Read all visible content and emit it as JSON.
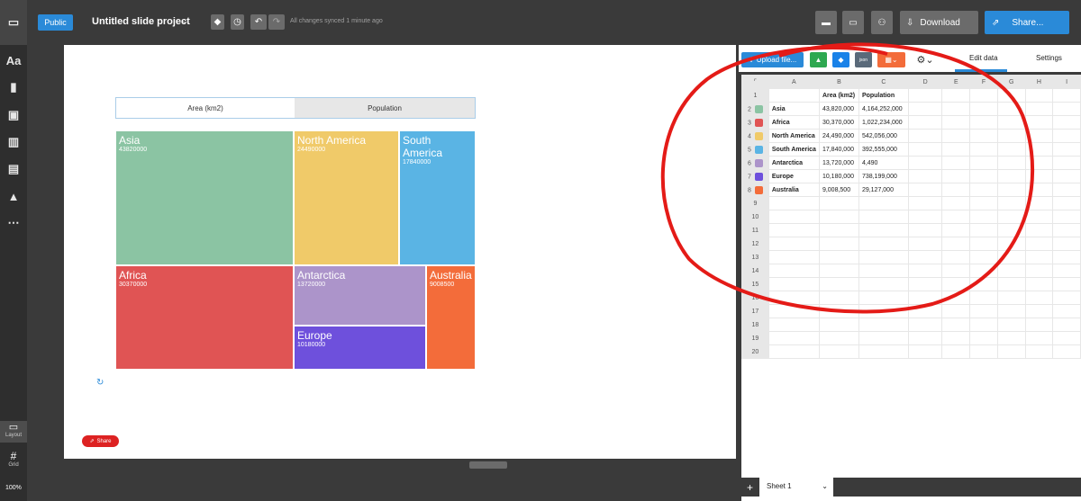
{
  "toolbar": {
    "public_label": "Public",
    "title": "Untitled slide project",
    "sync_text": "All changes synced 1 minute ago",
    "download_label": "Download",
    "share_label": "Share..."
  },
  "left_sidebar": {
    "text_tool": "Aa",
    "layout_label": "Layout",
    "grid_label": "Grid",
    "zoom": "100%"
  },
  "chart": {
    "tabs": [
      "Area (km2)",
      "Population"
    ],
    "share_label": "Share",
    "cells": [
      {
        "name": "Asia",
        "value": "43820000",
        "color": "#8bc4a3"
      },
      {
        "name": "North America",
        "value": "24490000",
        "color": "#f0ca69"
      },
      {
        "name": "South America",
        "value": "17840000",
        "color": "#5ab4e4"
      },
      {
        "name": "Africa",
        "value": "30370000",
        "color": "#e05454"
      },
      {
        "name": "Antarctica",
        "value": "13720000",
        "color": "#ac94ca"
      },
      {
        "name": "Australia",
        "value": "9008500",
        "color": "#f36c3a"
      },
      {
        "name": "Europe",
        "value": "10180000",
        "color": "#6e50dc"
      }
    ]
  },
  "chart_data": {
    "type": "treemap",
    "series": "Area (km2)",
    "categories": [
      "Asia",
      "Africa",
      "North America",
      "South America",
      "Antarctica",
      "Europe",
      "Australia"
    ],
    "values": [
      43820000,
      30370000,
      24490000,
      17840000,
      13720000,
      10180000,
      9008500
    ]
  },
  "panel": {
    "upload_label": "Upload file...",
    "tabs": {
      "edit": "Edit data",
      "settings": "Settings"
    },
    "sheet_name": "Sheet 1",
    "columns": [
      "A",
      "B",
      "C",
      "D",
      "E",
      "F",
      "G",
      "H",
      "I"
    ],
    "header_row": [
      "",
      "Area (km2)",
      "Population"
    ],
    "rows": [
      {
        "n": "2",
        "name": "Asia",
        "area": "43,820,000",
        "pop": "4,164,252,000",
        "color": "#8bc4a3"
      },
      {
        "n": "3",
        "name": "Africa",
        "area": "30,370,000",
        "pop": "1,022,234,000",
        "color": "#e05454"
      },
      {
        "n": "4",
        "name": "North America",
        "area": "24,490,000",
        "pop": "542,056,000",
        "color": "#f0ca69"
      },
      {
        "n": "5",
        "name": "South America",
        "area": "17,840,000",
        "pop": "392,555,000",
        "color": "#5ab4e4"
      },
      {
        "n": "6",
        "name": "Antarctica",
        "area": "13,720,000",
        "pop": "4,490",
        "color": "#ac94ca"
      },
      {
        "n": "7",
        "name": "Europe",
        "area": "10,180,000",
        "pop": "738,199,000",
        "color": "#6e50dc"
      },
      {
        "n": "8",
        "name": "Australia",
        "area": "9,008,500",
        "pop": "29,127,000",
        "color": "#f36c3a"
      }
    ],
    "empty_rows": [
      "9",
      "10",
      "11",
      "12",
      "13",
      "14",
      "15",
      "16",
      "17",
      "18",
      "19",
      "20"
    ]
  }
}
